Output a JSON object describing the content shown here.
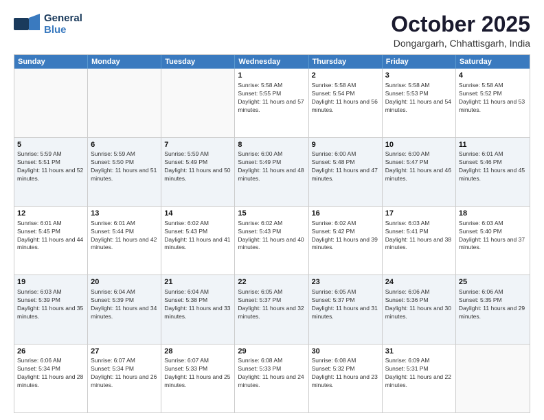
{
  "header": {
    "logo_line1": "General",
    "logo_line2": "Blue",
    "month": "October 2025",
    "location": "Dongargarh, Chhattisgarh, India"
  },
  "weekdays": [
    "Sunday",
    "Monday",
    "Tuesday",
    "Wednesday",
    "Thursday",
    "Friday",
    "Saturday"
  ],
  "rows": [
    [
      {
        "day": "",
        "empty": true
      },
      {
        "day": "",
        "empty": true
      },
      {
        "day": "",
        "empty": true
      },
      {
        "day": "1",
        "info": "Sunrise: 5:58 AM\nSunset: 5:55 PM\nDaylight: 11 hours and 57 minutes."
      },
      {
        "day": "2",
        "info": "Sunrise: 5:58 AM\nSunset: 5:54 PM\nDaylight: 11 hours and 56 minutes."
      },
      {
        "day": "3",
        "info": "Sunrise: 5:58 AM\nSunset: 5:53 PM\nDaylight: 11 hours and 54 minutes."
      },
      {
        "day": "4",
        "info": "Sunrise: 5:58 AM\nSunset: 5:52 PM\nDaylight: 11 hours and 53 minutes."
      }
    ],
    [
      {
        "day": "5",
        "info": "Sunrise: 5:59 AM\nSunset: 5:51 PM\nDaylight: 11 hours and 52 minutes."
      },
      {
        "day": "6",
        "info": "Sunrise: 5:59 AM\nSunset: 5:50 PM\nDaylight: 11 hours and 51 minutes."
      },
      {
        "day": "7",
        "info": "Sunrise: 5:59 AM\nSunset: 5:49 PM\nDaylight: 11 hours and 50 minutes."
      },
      {
        "day": "8",
        "info": "Sunrise: 6:00 AM\nSunset: 5:49 PM\nDaylight: 11 hours and 48 minutes."
      },
      {
        "day": "9",
        "info": "Sunrise: 6:00 AM\nSunset: 5:48 PM\nDaylight: 11 hours and 47 minutes."
      },
      {
        "day": "10",
        "info": "Sunrise: 6:00 AM\nSunset: 5:47 PM\nDaylight: 11 hours and 46 minutes."
      },
      {
        "day": "11",
        "info": "Sunrise: 6:01 AM\nSunset: 5:46 PM\nDaylight: 11 hours and 45 minutes."
      }
    ],
    [
      {
        "day": "12",
        "info": "Sunrise: 6:01 AM\nSunset: 5:45 PM\nDaylight: 11 hours and 44 minutes."
      },
      {
        "day": "13",
        "info": "Sunrise: 6:01 AM\nSunset: 5:44 PM\nDaylight: 11 hours and 42 minutes."
      },
      {
        "day": "14",
        "info": "Sunrise: 6:02 AM\nSunset: 5:43 PM\nDaylight: 11 hours and 41 minutes."
      },
      {
        "day": "15",
        "info": "Sunrise: 6:02 AM\nSunset: 5:43 PM\nDaylight: 11 hours and 40 minutes."
      },
      {
        "day": "16",
        "info": "Sunrise: 6:02 AM\nSunset: 5:42 PM\nDaylight: 11 hours and 39 minutes."
      },
      {
        "day": "17",
        "info": "Sunrise: 6:03 AM\nSunset: 5:41 PM\nDaylight: 11 hours and 38 minutes."
      },
      {
        "day": "18",
        "info": "Sunrise: 6:03 AM\nSunset: 5:40 PM\nDaylight: 11 hours and 37 minutes."
      }
    ],
    [
      {
        "day": "19",
        "info": "Sunrise: 6:03 AM\nSunset: 5:39 PM\nDaylight: 11 hours and 35 minutes."
      },
      {
        "day": "20",
        "info": "Sunrise: 6:04 AM\nSunset: 5:39 PM\nDaylight: 11 hours and 34 minutes."
      },
      {
        "day": "21",
        "info": "Sunrise: 6:04 AM\nSunset: 5:38 PM\nDaylight: 11 hours and 33 minutes."
      },
      {
        "day": "22",
        "info": "Sunrise: 6:05 AM\nSunset: 5:37 PM\nDaylight: 11 hours and 32 minutes."
      },
      {
        "day": "23",
        "info": "Sunrise: 6:05 AM\nSunset: 5:37 PM\nDaylight: 11 hours and 31 minutes."
      },
      {
        "day": "24",
        "info": "Sunrise: 6:06 AM\nSunset: 5:36 PM\nDaylight: 11 hours and 30 minutes."
      },
      {
        "day": "25",
        "info": "Sunrise: 6:06 AM\nSunset: 5:35 PM\nDaylight: 11 hours and 29 minutes."
      }
    ],
    [
      {
        "day": "26",
        "info": "Sunrise: 6:06 AM\nSunset: 5:34 PM\nDaylight: 11 hours and 28 minutes."
      },
      {
        "day": "27",
        "info": "Sunrise: 6:07 AM\nSunset: 5:34 PM\nDaylight: 11 hours and 26 minutes."
      },
      {
        "day": "28",
        "info": "Sunrise: 6:07 AM\nSunset: 5:33 PM\nDaylight: 11 hours and 25 minutes."
      },
      {
        "day": "29",
        "info": "Sunrise: 6:08 AM\nSunset: 5:33 PM\nDaylight: 11 hours and 24 minutes."
      },
      {
        "day": "30",
        "info": "Sunrise: 6:08 AM\nSunset: 5:32 PM\nDaylight: 11 hours and 23 minutes."
      },
      {
        "day": "31",
        "info": "Sunrise: 6:09 AM\nSunset: 5:31 PM\nDaylight: 11 hours and 22 minutes."
      },
      {
        "day": "",
        "empty": true
      }
    ]
  ]
}
